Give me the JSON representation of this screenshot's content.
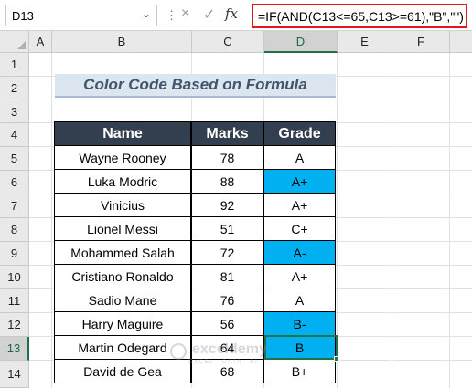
{
  "formula_bar": {
    "name_box": "D13",
    "cancel_icon": "×",
    "enter_icon": "✓",
    "fx_icon": "fx",
    "formula": "=IF(AND(C13<=65,C13>=61),\"B\",\"\")"
  },
  "columns": [
    "A",
    "B",
    "C",
    "D",
    "E",
    "F"
  ],
  "rows": [
    "1",
    "2",
    "3",
    "4",
    "5",
    "6",
    "7",
    "8",
    "9",
    "10",
    "11",
    "12",
    "13",
    "14"
  ],
  "selected": {
    "column": "D",
    "row": "13"
  },
  "title": "Color Code Based on Formula",
  "table": {
    "headers": [
      "Name",
      "Marks",
      "Grade"
    ],
    "rows": [
      {
        "name": "Wayne Rooney",
        "marks": "78",
        "grade": "A",
        "highlight": false
      },
      {
        "name": "Luka Modric",
        "marks": "88",
        "grade": "A+",
        "highlight": true
      },
      {
        "name": "Vinicius",
        "marks": "92",
        "grade": "A+",
        "highlight": false
      },
      {
        "name": "Lionel Messi",
        "marks": "51",
        "grade": "C+",
        "highlight": false
      },
      {
        "name": "Mohammed Salah",
        "marks": "72",
        "grade": "A-",
        "highlight": true
      },
      {
        "name": "Cristiano Ronaldo",
        "marks": "81",
        "grade": "A+",
        "highlight": false
      },
      {
        "name": "Sadio Mane",
        "marks": "76",
        "grade": "A",
        "highlight": false
      },
      {
        "name": "Harry Maguire",
        "marks": "56",
        "grade": "B-",
        "highlight": true
      },
      {
        "name": "Martin Odegard",
        "marks": "64",
        "grade": "B",
        "highlight": true
      },
      {
        "name": "David de Gea",
        "marks": "68",
        "grade": "B+",
        "highlight": false
      }
    ]
  },
  "colors": {
    "header_fill": "#333f4f",
    "highlight_fill": "#00b0f0",
    "selection": "#217346",
    "formula_outline": "#e0191b"
  },
  "watermark": {
    "name": "exceldemy",
    "tagline": "EXCEL · DATA · BI"
  }
}
